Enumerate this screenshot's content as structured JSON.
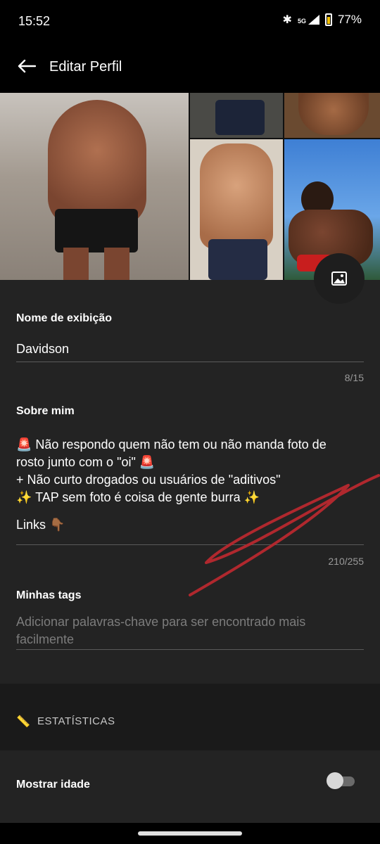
{
  "status_bar": {
    "time": "15:52",
    "network": "5G",
    "battery": "77%",
    "icons": [
      "bluetooth-icon",
      "signal-icon",
      "battery-icon"
    ]
  },
  "app_bar": {
    "title": "Editar Perfil",
    "back_icon": "arrow-left-icon"
  },
  "photos": {
    "count": 5,
    "add_photo_icon": "image-icon"
  },
  "display_name": {
    "label": "Nome de exibição",
    "value": "Davidson",
    "counter": "8/15"
  },
  "about": {
    "label": "Sobre mim",
    "lines": [
      "🚨 Não respondo quem não tem ou não manda foto de",
      "rosto junto com o \"oi\" 🚨",
      "+ Não curto drogados ou usuários de \"aditivos\"",
      "✨ TAP sem foto é coisa de gente burra ✨",
      "",
      "Links 👇🏾"
    ],
    "counter": "210/255"
  },
  "tags": {
    "label": "Minhas tags",
    "placeholder": "Adicionar palavras-chave para ser encontrado mais facilmente"
  },
  "stats": {
    "title": "ESTATÍSTICAS",
    "icon": "ruler-icon"
  },
  "show_age": {
    "label": "Mostrar idade",
    "enabled": false
  },
  "colors": {
    "background": "#000000",
    "surface": "#232323",
    "section": "#1a1a1a",
    "scribble": "#b0282e"
  }
}
